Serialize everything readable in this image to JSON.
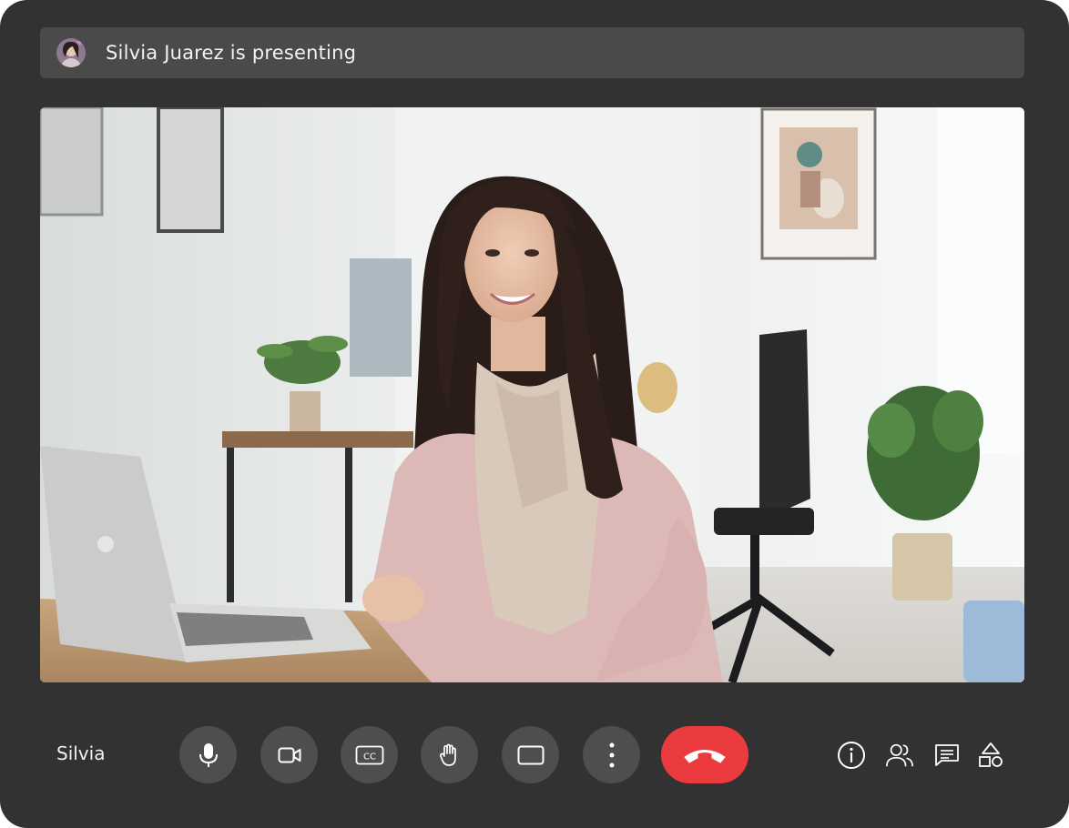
{
  "banner": {
    "presenter_text": "Silvia Juarez is presenting",
    "avatar_icon": "presenter-avatar"
  },
  "video": {
    "description_icon": "participant-video-feed"
  },
  "footer": {
    "self_name": "Silvia",
    "controls": [
      {
        "name": "microphone",
        "icon": "microphone-icon"
      },
      {
        "name": "camera",
        "icon": "camera-icon"
      },
      {
        "name": "captions",
        "icon": "closed-captions-icon",
        "label": "CC"
      },
      {
        "name": "raise-hand",
        "icon": "hand-icon"
      },
      {
        "name": "present",
        "icon": "present-screen-icon"
      },
      {
        "name": "more-options",
        "icon": "more-vertical-icon"
      },
      {
        "name": "end-call",
        "icon": "phone-hangup-icon"
      }
    ],
    "side_actions": [
      {
        "name": "meeting-details",
        "icon": "info-icon"
      },
      {
        "name": "people",
        "icon": "people-icon"
      },
      {
        "name": "chat",
        "icon": "chat-icon"
      },
      {
        "name": "activities",
        "icon": "shapes-icon"
      }
    ]
  },
  "colors": {
    "frame": "#323232",
    "banner": "#4a4a4a",
    "control": "#4e4e4e",
    "end_call": "#ec3b3f",
    "text": "#f2f2f2"
  }
}
